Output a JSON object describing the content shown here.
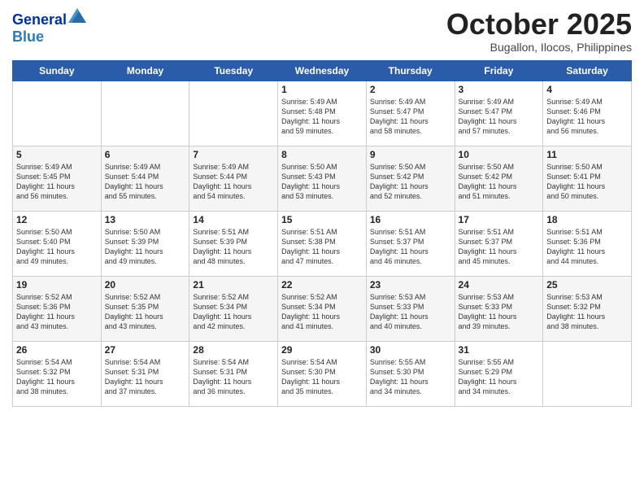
{
  "header": {
    "logo_line1": "General",
    "logo_line2": "Blue",
    "month": "October 2025",
    "location": "Bugallon, Ilocos, Philippines"
  },
  "weekdays": [
    "Sunday",
    "Monday",
    "Tuesday",
    "Wednesday",
    "Thursday",
    "Friday",
    "Saturday"
  ],
  "weeks": [
    [
      {
        "day": "",
        "text": ""
      },
      {
        "day": "",
        "text": ""
      },
      {
        "day": "",
        "text": ""
      },
      {
        "day": "1",
        "text": "Sunrise: 5:49 AM\nSunset: 5:48 PM\nDaylight: 11 hours\nand 59 minutes."
      },
      {
        "day": "2",
        "text": "Sunrise: 5:49 AM\nSunset: 5:47 PM\nDaylight: 11 hours\nand 58 minutes."
      },
      {
        "day": "3",
        "text": "Sunrise: 5:49 AM\nSunset: 5:47 PM\nDaylight: 11 hours\nand 57 minutes."
      },
      {
        "day": "4",
        "text": "Sunrise: 5:49 AM\nSunset: 5:46 PM\nDaylight: 11 hours\nand 56 minutes."
      }
    ],
    [
      {
        "day": "5",
        "text": "Sunrise: 5:49 AM\nSunset: 5:45 PM\nDaylight: 11 hours\nand 56 minutes."
      },
      {
        "day": "6",
        "text": "Sunrise: 5:49 AM\nSunset: 5:44 PM\nDaylight: 11 hours\nand 55 minutes."
      },
      {
        "day": "7",
        "text": "Sunrise: 5:49 AM\nSunset: 5:44 PM\nDaylight: 11 hours\nand 54 minutes."
      },
      {
        "day": "8",
        "text": "Sunrise: 5:50 AM\nSunset: 5:43 PM\nDaylight: 11 hours\nand 53 minutes."
      },
      {
        "day": "9",
        "text": "Sunrise: 5:50 AM\nSunset: 5:42 PM\nDaylight: 11 hours\nand 52 minutes."
      },
      {
        "day": "10",
        "text": "Sunrise: 5:50 AM\nSunset: 5:42 PM\nDaylight: 11 hours\nand 51 minutes."
      },
      {
        "day": "11",
        "text": "Sunrise: 5:50 AM\nSunset: 5:41 PM\nDaylight: 11 hours\nand 50 minutes."
      }
    ],
    [
      {
        "day": "12",
        "text": "Sunrise: 5:50 AM\nSunset: 5:40 PM\nDaylight: 11 hours\nand 49 minutes."
      },
      {
        "day": "13",
        "text": "Sunrise: 5:50 AM\nSunset: 5:39 PM\nDaylight: 11 hours\nand 49 minutes."
      },
      {
        "day": "14",
        "text": "Sunrise: 5:51 AM\nSunset: 5:39 PM\nDaylight: 11 hours\nand 48 minutes."
      },
      {
        "day": "15",
        "text": "Sunrise: 5:51 AM\nSunset: 5:38 PM\nDaylight: 11 hours\nand 47 minutes."
      },
      {
        "day": "16",
        "text": "Sunrise: 5:51 AM\nSunset: 5:37 PM\nDaylight: 11 hours\nand 46 minutes."
      },
      {
        "day": "17",
        "text": "Sunrise: 5:51 AM\nSunset: 5:37 PM\nDaylight: 11 hours\nand 45 minutes."
      },
      {
        "day": "18",
        "text": "Sunrise: 5:51 AM\nSunset: 5:36 PM\nDaylight: 11 hours\nand 44 minutes."
      }
    ],
    [
      {
        "day": "19",
        "text": "Sunrise: 5:52 AM\nSunset: 5:36 PM\nDaylight: 11 hours\nand 43 minutes."
      },
      {
        "day": "20",
        "text": "Sunrise: 5:52 AM\nSunset: 5:35 PM\nDaylight: 11 hours\nand 43 minutes."
      },
      {
        "day": "21",
        "text": "Sunrise: 5:52 AM\nSunset: 5:34 PM\nDaylight: 11 hours\nand 42 minutes."
      },
      {
        "day": "22",
        "text": "Sunrise: 5:52 AM\nSunset: 5:34 PM\nDaylight: 11 hours\nand 41 minutes."
      },
      {
        "day": "23",
        "text": "Sunrise: 5:53 AM\nSunset: 5:33 PM\nDaylight: 11 hours\nand 40 minutes."
      },
      {
        "day": "24",
        "text": "Sunrise: 5:53 AM\nSunset: 5:33 PM\nDaylight: 11 hours\nand 39 minutes."
      },
      {
        "day": "25",
        "text": "Sunrise: 5:53 AM\nSunset: 5:32 PM\nDaylight: 11 hours\nand 38 minutes."
      }
    ],
    [
      {
        "day": "26",
        "text": "Sunrise: 5:54 AM\nSunset: 5:32 PM\nDaylight: 11 hours\nand 38 minutes."
      },
      {
        "day": "27",
        "text": "Sunrise: 5:54 AM\nSunset: 5:31 PM\nDaylight: 11 hours\nand 37 minutes."
      },
      {
        "day": "28",
        "text": "Sunrise: 5:54 AM\nSunset: 5:31 PM\nDaylight: 11 hours\nand 36 minutes."
      },
      {
        "day": "29",
        "text": "Sunrise: 5:54 AM\nSunset: 5:30 PM\nDaylight: 11 hours\nand 35 minutes."
      },
      {
        "day": "30",
        "text": "Sunrise: 5:55 AM\nSunset: 5:30 PM\nDaylight: 11 hours\nand 34 minutes."
      },
      {
        "day": "31",
        "text": "Sunrise: 5:55 AM\nSunset: 5:29 PM\nDaylight: 11 hours\nand 34 minutes."
      },
      {
        "day": "",
        "text": ""
      }
    ]
  ]
}
